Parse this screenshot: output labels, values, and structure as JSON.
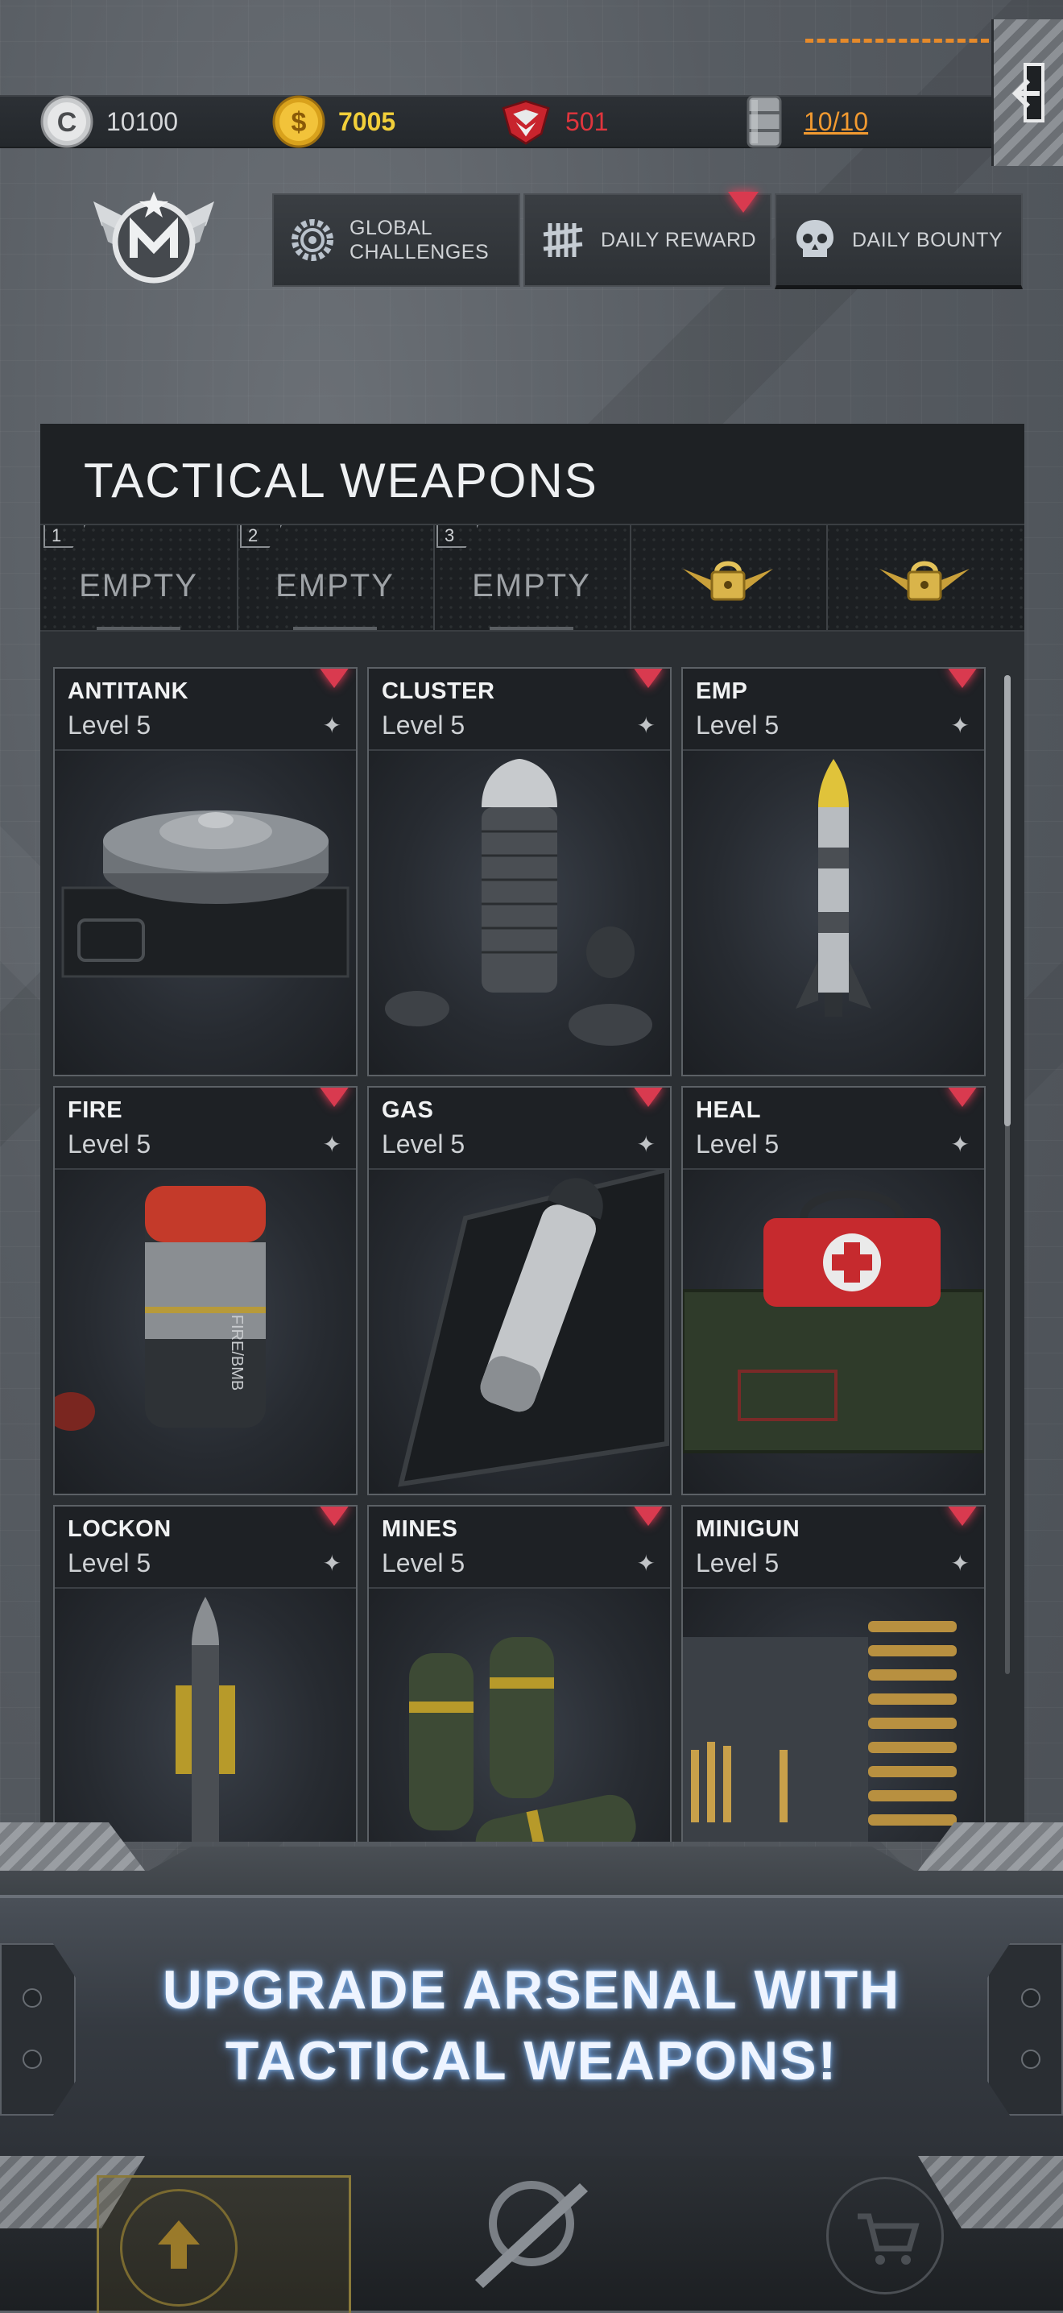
{
  "resources": {
    "credits": {
      "icon": "credits-coin-icon",
      "value": "10100"
    },
    "gold": {
      "icon": "gold-coin-icon",
      "value": "7005"
    },
    "rank": {
      "icon": "rank-emblem-icon",
      "value": "501"
    },
    "fuel": {
      "icon": "fuel-barrel-icon",
      "value": "10/10"
    }
  },
  "header": {
    "emblem": "wings-emblem-icon",
    "buttons": [
      {
        "label_1": "GLOBAL",
        "label_2": "CHALLENGES",
        "icon": "gear-badge-icon"
      },
      {
        "label": "DAILY REWARD",
        "icon": "tally-marks-icon"
      },
      {
        "label": "DAILY BOUNTY",
        "icon": "skull-icon"
      }
    ]
  },
  "panel": {
    "title": "TACTICAL WEAPONS",
    "slots": [
      {
        "num": "1",
        "label": "EMPTY"
      },
      {
        "num": "2",
        "label": "EMPTY"
      },
      {
        "num": "3",
        "label": "EMPTY"
      },
      {
        "icon": "locked-slot-icon"
      },
      {
        "icon": "locked-slot-icon"
      }
    ],
    "weapons": [
      {
        "name": "ANTITANK",
        "level": "Level 5"
      },
      {
        "name": "CLUSTER",
        "level": "Level 5"
      },
      {
        "name": "EMP",
        "level": "Level 5"
      },
      {
        "name": "FIRE",
        "level": "Level 5"
      },
      {
        "name": "GAS",
        "level": "Level 5"
      },
      {
        "name": "HEAL",
        "level": "Level 5"
      },
      {
        "name": "LOCKON",
        "level": "Level 5"
      },
      {
        "name": "MINES",
        "level": "Level 5"
      },
      {
        "name": "MINIGUN",
        "level": "Level 5"
      }
    ],
    "spark_glyph": "✦"
  },
  "banner": {
    "line1": "UPGRADE ARSENAL WITH",
    "line2": "TACTICAL WEAPONS!"
  },
  "colors": {
    "gold": "#f1cf3a",
    "rank_red": "#e0353d",
    "fuel_orange": "#f29a30",
    "notif": "#d93a4f"
  }
}
